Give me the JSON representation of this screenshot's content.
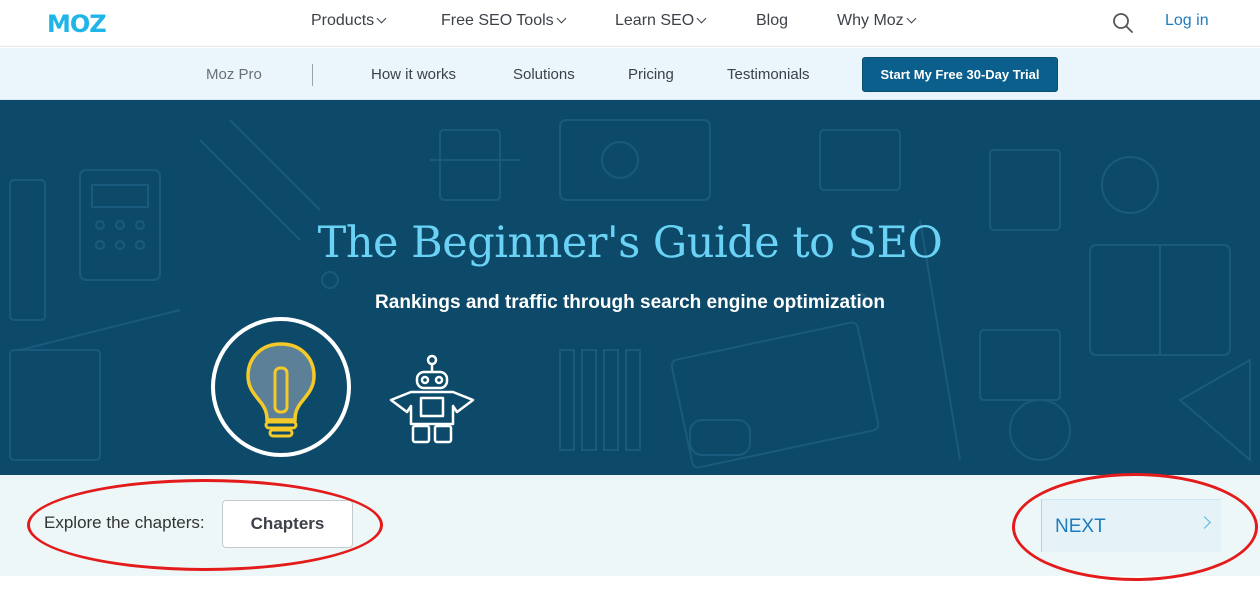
{
  "topnav": {
    "logo": "MOZ",
    "items": [
      {
        "label": "Products",
        "dropdown": true
      },
      {
        "label": "Free SEO Tools",
        "dropdown": true
      },
      {
        "label": "Learn SEO",
        "dropdown": true
      },
      {
        "label": "Blog",
        "dropdown": false
      },
      {
        "label": "Why Moz",
        "dropdown": true
      }
    ],
    "search_icon": "search-icon",
    "login": "Log in"
  },
  "subnav": {
    "product": "Moz Pro",
    "items": [
      "How it works",
      "Solutions",
      "Pricing",
      "Testimonials"
    ],
    "cta": "Start My Free 30-Day Trial"
  },
  "hero": {
    "title": "The Beginner's Guide to SEO",
    "subtitle": "Rankings and traffic through search engine optimization",
    "icons": [
      "lightbulb-icon",
      "robot-icon"
    ]
  },
  "chapters": {
    "explore_label": "Explore the chapters:",
    "button": "Chapters",
    "next": "NEXT"
  },
  "colors": {
    "brand": "#1fb5e8",
    "link": "#1d7bbf",
    "cta_bg": "#0b5f8c",
    "hero_bg": "#0d4a6a",
    "hero_title": "#6ad2f5",
    "annotation": "#e31b1b"
  }
}
